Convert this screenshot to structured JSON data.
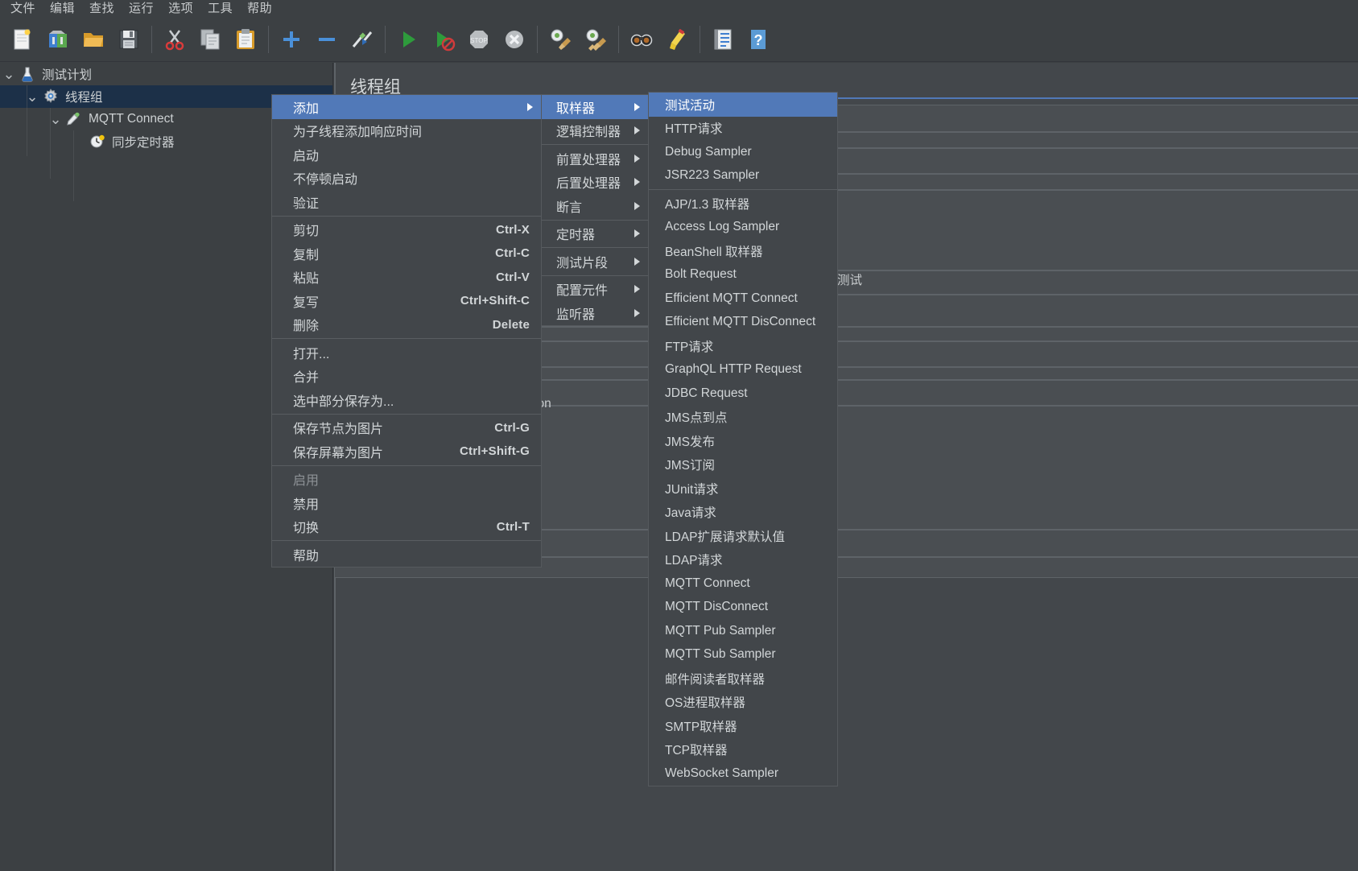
{
  "app": {
    "title": "Apache JMeter",
    "theme_bg": "#3c4043",
    "accent": "#5179b8",
    "selection_bg": "#1c3048"
  },
  "menubar": {
    "items": [
      {
        "name": "file",
        "label": "文件"
      },
      {
        "name": "edit",
        "label": "编辑"
      },
      {
        "name": "search",
        "label": "查找"
      },
      {
        "name": "run",
        "label": "运行"
      },
      {
        "name": "options",
        "label": "选项"
      },
      {
        "name": "tools",
        "label": "工具"
      },
      {
        "name": "help",
        "label": "帮助"
      }
    ]
  },
  "toolbar": {
    "items": [
      {
        "name": "new-icon",
        "glyph": "new"
      },
      {
        "name": "templates-icon",
        "glyph": "templates"
      },
      {
        "name": "open-icon",
        "glyph": "open"
      },
      {
        "name": "save-icon",
        "glyph": "save"
      },
      {
        "name": "separator",
        "glyph": "sep"
      },
      {
        "name": "cut-icon",
        "glyph": "cut"
      },
      {
        "name": "copy-icon",
        "glyph": "copy"
      },
      {
        "name": "paste-icon",
        "glyph": "paste"
      },
      {
        "name": "separator",
        "glyph": "sep"
      },
      {
        "name": "expand-all-icon",
        "glyph": "plus"
      },
      {
        "name": "collapse-all-icon",
        "glyph": "minus"
      },
      {
        "name": "toggle-icon",
        "glyph": "toggle"
      },
      {
        "name": "separator",
        "glyph": "sep"
      },
      {
        "name": "start-icon",
        "glyph": "start"
      },
      {
        "name": "start-no-pause-icon",
        "glyph": "start-nopause"
      },
      {
        "name": "stop-icon",
        "glyph": "stop"
      },
      {
        "name": "shutdown-icon",
        "glyph": "shutdown"
      },
      {
        "name": "separator",
        "glyph": "sep"
      },
      {
        "name": "clear-icon",
        "glyph": "clear"
      },
      {
        "name": "clear-all-icon",
        "glyph": "clear-all"
      },
      {
        "name": "separator",
        "glyph": "sep"
      },
      {
        "name": "search-icon",
        "glyph": "search"
      },
      {
        "name": "reset-search-icon",
        "glyph": "reset-search"
      },
      {
        "name": "separator",
        "glyph": "sep"
      },
      {
        "name": "function-helper-icon",
        "glyph": "function"
      },
      {
        "name": "help-icon",
        "glyph": "help"
      }
    ]
  },
  "tree": {
    "nodes": [
      {
        "name": "test-plan",
        "label": "测试计划",
        "depth": 0,
        "icon": "flask-icon",
        "expanded": true,
        "selected": false
      },
      {
        "name": "thread-group",
        "label": "线程组",
        "depth": 1,
        "icon": "gear-icon",
        "expanded": true,
        "selected": true
      },
      {
        "name": "mqtt-connect",
        "label": "MQTT Connect",
        "depth": 2,
        "icon": "pipette-icon",
        "expanded": true,
        "selected": false
      },
      {
        "name": "sync-timer",
        "label": "同步定时器",
        "depth": 3,
        "icon": "clock-icon",
        "expanded": null,
        "selected": false
      }
    ]
  },
  "content": {
    "title": "线程组",
    "inline_text_left": "ion",
    "inline_text_right": "测试"
  },
  "context_menu": {
    "name": "tree-context-menu",
    "items": [
      {
        "name": "add",
        "label": "添加",
        "accel": "",
        "submenu": true,
        "selected": true,
        "disabled": false
      },
      {
        "name": "add-think-times",
        "label": "为子线程添加响应时间",
        "accel": "",
        "submenu": false,
        "selected": false,
        "disabled": false
      },
      {
        "name": "start",
        "label": "启动",
        "accel": "",
        "submenu": false,
        "selected": false,
        "disabled": false
      },
      {
        "name": "start-no-pauses",
        "label": "不停顿启动",
        "accel": "",
        "submenu": false,
        "selected": false,
        "disabled": false
      },
      {
        "name": "validate",
        "label": "验证",
        "accel": "",
        "submenu": false,
        "selected": false,
        "disabled": false
      },
      {
        "name": "separator-1",
        "label": "",
        "accel": "",
        "submenu": false,
        "separator": true
      },
      {
        "name": "cut",
        "label": "剪切",
        "accel": "Ctrl-X",
        "submenu": false,
        "selected": false,
        "disabled": false
      },
      {
        "name": "copy",
        "label": "复制",
        "accel": "Ctrl-C",
        "submenu": false,
        "selected": false,
        "disabled": false
      },
      {
        "name": "paste",
        "label": "粘贴",
        "accel": "Ctrl-V",
        "submenu": false,
        "selected": false,
        "disabled": false
      },
      {
        "name": "duplicate",
        "label": "复写",
        "accel": "Ctrl+Shift-C",
        "submenu": false,
        "selected": false,
        "disabled": false
      },
      {
        "name": "remove",
        "label": "删除",
        "accel": "Delete",
        "submenu": false,
        "selected": false,
        "disabled": false
      },
      {
        "name": "separator-2",
        "label": "",
        "accel": "",
        "submenu": false,
        "separator": true
      },
      {
        "name": "open",
        "label": "打开...",
        "accel": "",
        "submenu": false,
        "selected": false,
        "disabled": false
      },
      {
        "name": "merge",
        "label": "合并",
        "accel": "",
        "submenu": false,
        "selected": false,
        "disabled": false
      },
      {
        "name": "save-selection-as",
        "label": "选中部分保存为...",
        "accel": "",
        "submenu": false,
        "selected": false,
        "disabled": false
      },
      {
        "name": "separator-3",
        "label": "",
        "accel": "",
        "submenu": false,
        "separator": true
      },
      {
        "name": "save-node-as-image",
        "label": "保存节点为图片",
        "accel": "Ctrl-G",
        "submenu": false,
        "selected": false,
        "disabled": false
      },
      {
        "name": "save-screen-as-image",
        "label": "保存屏幕为图片",
        "accel": "Ctrl+Shift-G",
        "submenu": false,
        "selected": false,
        "disabled": false
      },
      {
        "name": "separator-4",
        "label": "",
        "accel": "",
        "submenu": false,
        "separator": true
      },
      {
        "name": "enable",
        "label": "启用",
        "accel": "",
        "submenu": false,
        "selected": false,
        "disabled": true
      },
      {
        "name": "disable",
        "label": "禁用",
        "accel": "",
        "submenu": false,
        "selected": false,
        "disabled": false
      },
      {
        "name": "toggle",
        "label": "切换",
        "accel": "Ctrl-T",
        "submenu": false,
        "selected": false,
        "disabled": false
      },
      {
        "name": "separator-5",
        "label": "",
        "accel": "",
        "submenu": false,
        "separator": true
      },
      {
        "name": "help",
        "label": "帮助",
        "accel": "",
        "submenu": false,
        "selected": false,
        "disabled": false
      }
    ]
  },
  "add_submenu": {
    "name": "add-submenu",
    "items": [
      {
        "name": "sampler",
        "label": "取样器",
        "submenu": true,
        "selected": true
      },
      {
        "name": "logic-controller",
        "label": "逻辑控制器",
        "submenu": true,
        "selected": false
      },
      {
        "name": "separator-1",
        "label": "",
        "separator": true
      },
      {
        "name": "pre-processor",
        "label": "前置处理器",
        "submenu": true,
        "selected": false
      },
      {
        "name": "post-processor",
        "label": "后置处理器",
        "submenu": true,
        "selected": false
      },
      {
        "name": "assertion",
        "label": "断言",
        "submenu": true,
        "selected": false
      },
      {
        "name": "separator-2",
        "label": "",
        "separator": true
      },
      {
        "name": "timer",
        "label": "定时器",
        "submenu": true,
        "selected": false
      },
      {
        "name": "separator-3",
        "label": "",
        "separator": true
      },
      {
        "name": "test-fragment",
        "label": "测试片段",
        "submenu": true,
        "selected": false
      },
      {
        "name": "separator-4",
        "label": "",
        "separator": true
      },
      {
        "name": "config-element",
        "label": "配置元件",
        "submenu": true,
        "selected": false
      },
      {
        "name": "listener",
        "label": "监听器",
        "submenu": true,
        "selected": false
      }
    ]
  },
  "sampler_submenu": {
    "name": "sampler-submenu",
    "items": [
      {
        "name": "test-action",
        "label": "测试活动",
        "selected": true
      },
      {
        "name": "http-request",
        "label": "HTTP请求",
        "selected": false
      },
      {
        "name": "debug-sampler",
        "label": "Debug Sampler",
        "selected": false
      },
      {
        "name": "jsr223-sampler",
        "label": "JSR223 Sampler",
        "selected": false
      },
      {
        "name": "separator-1",
        "label": "",
        "separator": true
      },
      {
        "name": "ajp-sampler",
        "label": "AJP/1.3 取样器",
        "selected": false
      },
      {
        "name": "access-log-sampler",
        "label": "Access Log Sampler",
        "selected": false
      },
      {
        "name": "beanshell-sampler",
        "label": "BeanShell 取样器",
        "selected": false
      },
      {
        "name": "bolt-request",
        "label": "Bolt Request",
        "selected": false
      },
      {
        "name": "efficient-mqtt-connect",
        "label": "Efficient MQTT Connect",
        "selected": false
      },
      {
        "name": "efficient-mqtt-disconnect",
        "label": "Efficient MQTT DisConnect",
        "selected": false
      },
      {
        "name": "ftp-request",
        "label": "FTP请求",
        "selected": false
      },
      {
        "name": "graphql-http-request",
        "label": "GraphQL HTTP Request",
        "selected": false
      },
      {
        "name": "jdbc-request",
        "label": "JDBC Request",
        "selected": false
      },
      {
        "name": "jms-point-to-point",
        "label": "JMS点到点",
        "selected": false
      },
      {
        "name": "jms-publisher",
        "label": "JMS发布",
        "selected": false
      },
      {
        "name": "jms-subscriber",
        "label": "JMS订阅",
        "selected": false
      },
      {
        "name": "junit-request",
        "label": "JUnit请求",
        "selected": false
      },
      {
        "name": "java-request",
        "label": "Java请求",
        "selected": false
      },
      {
        "name": "ldap-ext-request-defaults",
        "label": "LDAP扩展请求默认值",
        "selected": false
      },
      {
        "name": "ldap-request",
        "label": "LDAP请求",
        "selected": false
      },
      {
        "name": "mqtt-connect",
        "label": "MQTT Connect",
        "selected": false
      },
      {
        "name": "mqtt-disconnect",
        "label": "MQTT DisConnect",
        "selected": false
      },
      {
        "name": "mqtt-pub-sampler",
        "label": "MQTT Pub Sampler",
        "selected": false
      },
      {
        "name": "mqtt-sub-sampler",
        "label": "MQTT Sub Sampler",
        "selected": false
      },
      {
        "name": "mail-reader-sampler",
        "label": "邮件阅读者取样器",
        "selected": false
      },
      {
        "name": "os-process-sampler",
        "label": "OS进程取样器",
        "selected": false
      },
      {
        "name": "smtp-sampler",
        "label": "SMTP取样器",
        "selected": false
      },
      {
        "name": "tcp-sampler",
        "label": "TCP取样器",
        "selected": false
      },
      {
        "name": "websocket-sampler",
        "label": "WebSocket Sampler",
        "selected": false
      }
    ]
  }
}
